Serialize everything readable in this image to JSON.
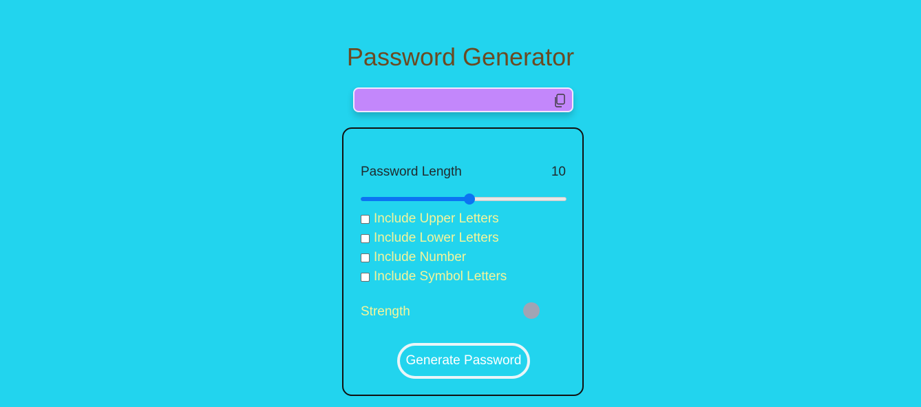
{
  "title": "Password Generator",
  "display": {
    "value": "",
    "copy_icon": "copy-icon"
  },
  "length": {
    "label": "Password Length",
    "value": "10",
    "slider_fraction": 0.53
  },
  "options": [
    {
      "label": "Include Upper Letters",
      "checked": false
    },
    {
      "label": "Include Lower Letters",
      "checked": false
    },
    {
      "label": "Include Number",
      "checked": false
    },
    {
      "label": "Include Symbol Letters",
      "checked": false
    }
  ],
  "strength": {
    "label": "Strength",
    "indicator_color": "#a0a4b4"
  },
  "generate_button": {
    "label": "Generate Password"
  },
  "colors": {
    "background": "#22d4ee",
    "title": "#6b4a22",
    "display": "#c387fb",
    "accent": "#0b74f2",
    "option_text": "#f4f59a"
  }
}
